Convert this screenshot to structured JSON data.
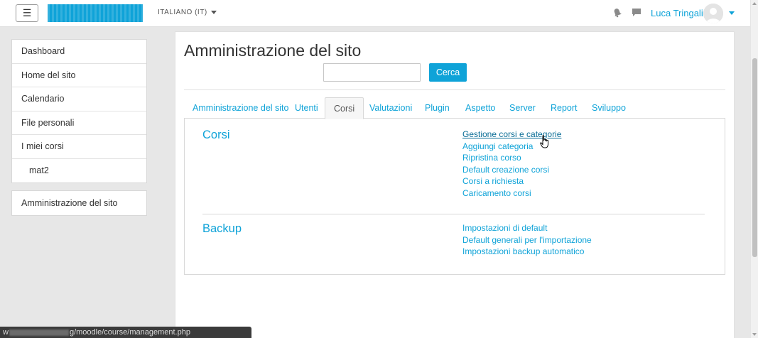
{
  "navbar": {
    "menu_icon": "hamburger-icon",
    "language": "ITALIANO (IT)",
    "notification_icon": "bell-icon",
    "message_icon": "chat-icon",
    "user_name": "Luca Tringali"
  },
  "sidebar": {
    "items": [
      {
        "label": "Dashboard"
      },
      {
        "label": "Home del sito"
      },
      {
        "label": "Calendario"
      },
      {
        "label": "File personali"
      },
      {
        "label": "I miei corsi"
      },
      {
        "label": "mat2"
      }
    ],
    "admin_label": "Amministrazione del sito"
  },
  "main": {
    "title": "Amministrazione del sito",
    "search": {
      "value": "",
      "button": "Cerca"
    },
    "tabs": [
      {
        "label": "Amministrazione del sito"
      },
      {
        "label": "Utenti"
      },
      {
        "label": "Corsi",
        "active": true
      },
      {
        "label": "Valutazioni"
      },
      {
        "label": "Plugin"
      },
      {
        "label": "Aspetto"
      },
      {
        "label": "Server"
      },
      {
        "label": "Report"
      },
      {
        "label": "Sviluppo"
      }
    ],
    "sections": [
      {
        "title": "Corsi",
        "links": [
          "Gestione corsi e categorie",
          "Aggiungi categoria",
          "Ripristina corso",
          "Default creazione corsi",
          "Corsi a richiesta",
          "Caricamento corsi"
        ]
      },
      {
        "title": "Backup",
        "links": [
          "Impostazioni di default",
          "Default generali per l'importazione",
          "Impostazioni backup automatico"
        ]
      }
    ]
  },
  "statusbar": {
    "prefix": "w",
    "url_suffix": "g/moodle/course/management.php"
  },
  "colors": {
    "accent": "#0fa3d8",
    "background": "#e7e7e7"
  }
}
